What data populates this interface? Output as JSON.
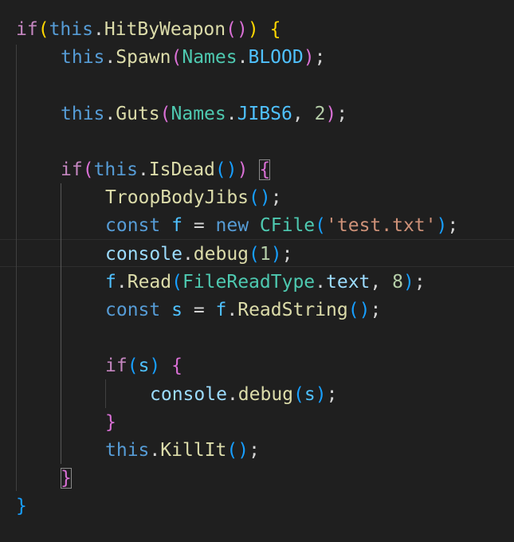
{
  "editor": {
    "colors": {
      "background": "#1f1f1f",
      "keyword_control": "#c586c0",
      "keyword": "#569cd6",
      "function": "#dcdcaa",
      "class": "#4ec9b0",
      "variable": "#9cdcfe",
      "constant": "#4fc1ff",
      "number": "#b5cea8",
      "string": "#ce9178",
      "bracket_level1": "#ffd700",
      "bracket_level2": "#da70d6",
      "bracket_level3": "#179fff"
    },
    "lines": [
      {
        "indent": 0,
        "tokens": [
          [
            "if",
            "kw-ctrl"
          ],
          [
            "(",
            "b1"
          ],
          [
            "this",
            "kw-this"
          ],
          [
            ".",
            "pun"
          ],
          [
            "HitByWeapon",
            "fn"
          ],
          [
            "(",
            "b2"
          ],
          [
            ")",
            "b2"
          ],
          [
            ")",
            "b1"
          ],
          [
            " ",
            "pun"
          ],
          [
            "{",
            "b1"
          ]
        ]
      },
      {
        "indent": 1,
        "tokens": [
          [
            "this",
            "kw-this"
          ],
          [
            ".",
            "pun"
          ],
          [
            "Spawn",
            "fn"
          ],
          [
            "(",
            "b2"
          ],
          [
            "Names",
            "cls"
          ],
          [
            ".",
            "pun"
          ],
          [
            "BLOOD",
            "const"
          ],
          [
            ")",
            "b2"
          ],
          [
            ";",
            "pun"
          ]
        ]
      },
      {
        "indent": 0,
        "tokens": []
      },
      {
        "indent": 1,
        "tokens": [
          [
            "this",
            "kw-this"
          ],
          [
            ".",
            "pun"
          ],
          [
            "Guts",
            "fn"
          ],
          [
            "(",
            "b2"
          ],
          [
            "Names",
            "cls"
          ],
          [
            ".",
            "pun"
          ],
          [
            "JIBS6",
            "const"
          ],
          [
            ", ",
            "pun"
          ],
          [
            "2",
            "num"
          ],
          [
            ")",
            "b2"
          ],
          [
            ";",
            "pun"
          ]
        ]
      },
      {
        "indent": 0,
        "tokens": []
      },
      {
        "indent": 1,
        "tokens": [
          [
            "if",
            "kw-ctrl"
          ],
          [
            "(",
            "b2"
          ],
          [
            "this",
            "kw-this"
          ],
          [
            ".",
            "pun"
          ],
          [
            "IsDead",
            "fn"
          ],
          [
            "(",
            "b3"
          ],
          [
            ")",
            "b3"
          ],
          [
            ")",
            "b2"
          ],
          [
            " ",
            "pun"
          ],
          [
            "{",
            "b2 box"
          ]
        ]
      },
      {
        "indent": 2,
        "tokens": [
          [
            "TroopBodyJibs",
            "fn"
          ],
          [
            "(",
            "b3"
          ],
          [
            ")",
            "b3"
          ],
          [
            ";",
            "pun"
          ]
        ]
      },
      {
        "indent": 2,
        "tokens": [
          [
            "const",
            "kw-decl"
          ],
          [
            " ",
            "pun"
          ],
          [
            "f",
            "const"
          ],
          [
            " = ",
            "pun"
          ],
          [
            "new",
            "kw-decl"
          ],
          [
            " ",
            "pun"
          ],
          [
            "CFile",
            "cls"
          ],
          [
            "(",
            "b3"
          ],
          [
            "'test.txt'",
            "str"
          ],
          [
            ")",
            "b3"
          ],
          [
            ";",
            "pun"
          ]
        ]
      },
      {
        "indent": 2,
        "tokens": [
          [
            "console",
            "var"
          ],
          [
            ".",
            "pun"
          ],
          [
            "debug",
            "fn"
          ],
          [
            "(",
            "b3"
          ],
          [
            "1",
            "num"
          ],
          [
            ")",
            "b3"
          ],
          [
            ";",
            "pun"
          ]
        ]
      },
      {
        "indent": 2,
        "tokens": [
          [
            "f",
            "const"
          ],
          [
            ".",
            "pun"
          ],
          [
            "Read",
            "fn"
          ],
          [
            "(",
            "b3"
          ],
          [
            "FileReadType",
            "cls"
          ],
          [
            ".",
            "pun"
          ],
          [
            "text",
            "var"
          ],
          [
            ", ",
            "pun"
          ],
          [
            "8",
            "num"
          ],
          [
            ")",
            "b3"
          ],
          [
            ";",
            "pun"
          ]
        ]
      },
      {
        "indent": 2,
        "tokens": [
          [
            "const",
            "kw-decl"
          ],
          [
            " ",
            "pun"
          ],
          [
            "s",
            "const"
          ],
          [
            " = ",
            "pun"
          ],
          [
            "f",
            "const"
          ],
          [
            ".",
            "pun"
          ],
          [
            "ReadString",
            "fn"
          ],
          [
            "(",
            "b3"
          ],
          [
            ")",
            "b3"
          ],
          [
            ";",
            "pun"
          ]
        ]
      },
      {
        "indent": 0,
        "tokens": []
      },
      {
        "indent": 2,
        "tokens": [
          [
            "if",
            "kw-ctrl"
          ],
          [
            "(",
            "b3"
          ],
          [
            "s",
            "const"
          ],
          [
            ")",
            "b3"
          ],
          [
            " ",
            "pun"
          ],
          [
            "{",
            "b2"
          ]
        ]
      },
      {
        "indent": 3,
        "tokens": [
          [
            "console",
            "var"
          ],
          [
            ".",
            "pun"
          ],
          [
            "debug",
            "fn"
          ],
          [
            "(",
            "b3"
          ],
          [
            "s",
            "const"
          ],
          [
            ")",
            "b3"
          ],
          [
            ";",
            "pun"
          ]
        ]
      },
      {
        "indent": 2,
        "tokens": [
          [
            "}",
            "b2"
          ]
        ]
      },
      {
        "indent": 2,
        "tokens": [
          [
            "this",
            "kw-this"
          ],
          [
            ".",
            "pun"
          ],
          [
            "KillIt",
            "fn"
          ],
          [
            "(",
            "b3"
          ],
          [
            ")",
            "b3"
          ],
          [
            ";",
            "pun"
          ]
        ]
      },
      {
        "indent": 1,
        "tokens": [
          [
            "}",
            "b2 box"
          ]
        ]
      },
      {
        "indent": 0,
        "tokens": [
          [
            "}",
            "b3"
          ]
        ]
      }
    ]
  }
}
